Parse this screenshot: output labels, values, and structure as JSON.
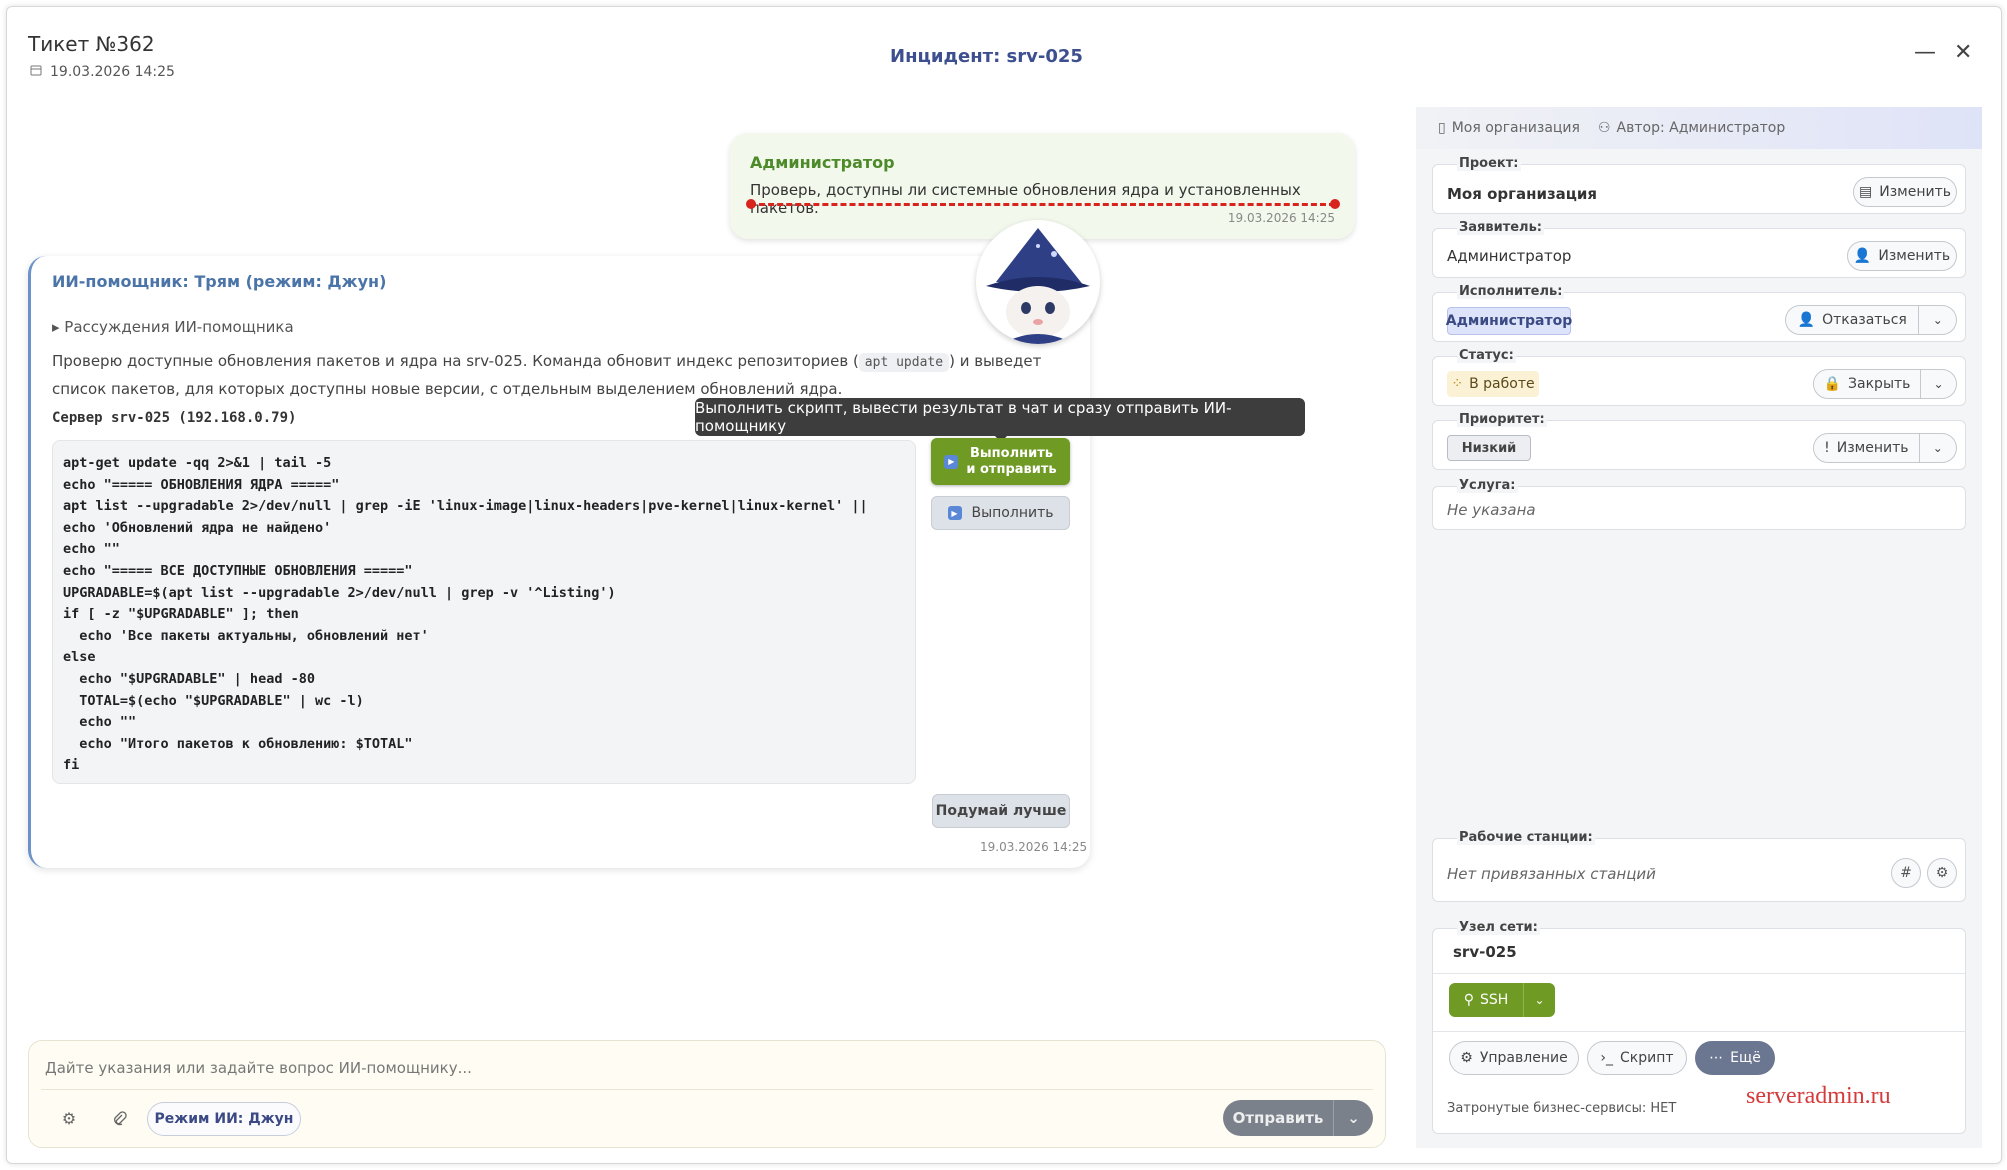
{
  "header": {
    "ticket_title": "Тикет №362",
    "ticket_date": "19.03.2026 14:25",
    "incident_title": "Инцидент: srv-025",
    "minimize": "—",
    "close": "✕"
  },
  "chat": {
    "user_msg": {
      "author": "Администратор",
      "text": "Проверь, доступны ли системные обновления ядра и установленных пакетов.",
      "time": "19.03.2026 14:25"
    },
    "ai_msg": {
      "author": "ИИ-помощник: Трям (режим: Джун)",
      "reasoning": "▸ Рассуждения ИИ-помощника",
      "para_before": "Проверю доступные обновления пакетов и ядра на srv-025. Команда обновит индекс репозиториев (",
      "para_code": "apt update",
      "para_after": ") и выведет список пакетов, для которых доступны новые версии, с отдельным выделением обновлений ядра.",
      "server": "Сервер srv-025 (192.168.0.79)",
      "code": "apt-get update -qq 2>&1 | tail -5\necho \"===== ОБНОВЛЕНИЯ ЯДРА =====\"\napt list --upgradable 2>/dev/null | grep -iE 'linux-image|linux-headers|pve-kernel|linux-kernel' ||\necho 'Обновлений ядра не найдено'\necho \"\"\necho \"===== ВСЕ ДОСТУПНЫЕ ОБНОВЛЕНИЯ =====\"\nUPGRADABLE=$(apt list --upgradable 2>/dev/null | grep -v '^Listing')\nif [ -z \"$UPGRADABLE\" ]; then\n  echo 'Все пакеты актуальны, обновлений нет'\nelse\n  echo \"$UPGRADABLE\" | head -80\n  TOTAL=$(echo \"$UPGRADABLE\" | wc -l)\n  echo \"\"\n  echo \"Итого пакетов к обновлению: $TOTAL\"\nfi",
      "btn_run_send_line1": "Выполнить",
      "btn_run_send_line2": "и отправить",
      "btn_run": "Выполнить",
      "tooltip": "Выполнить скрипт, вывести результат в чат и сразу отправить ИИ-помощнику",
      "btn_think": "Подумай лучше",
      "time": "19.03.2026 14:25"
    }
  },
  "composer": {
    "placeholder": "Дайте указания или задайте вопрос ИИ-помощнику...",
    "mode": "Режим ИИ: Джун",
    "send": "Отправить"
  },
  "panel": {
    "org": "Моя организация",
    "author": "Автор: Администратор",
    "project": {
      "label": "Проект:",
      "value": "Моя организация",
      "btn": "Изменить"
    },
    "requester": {
      "label": "Заявитель:",
      "value": "Администратор",
      "btn": "Изменить"
    },
    "assignee": {
      "label": "Исполнитель:",
      "value": "Администратор",
      "btn": "Отказаться"
    },
    "status": {
      "label": "Статус:",
      "value": "В работе",
      "btn": "Закрыть"
    },
    "priority": {
      "label": "Приоритет:",
      "value": "Низкий",
      "btn": "Изменить"
    },
    "service": {
      "label": "Услуга:",
      "value": "Не указана"
    },
    "workstations": {
      "label": "Рабочие станции:",
      "value": "Нет привязанных станций"
    },
    "node": {
      "label": "Узел сети:",
      "value": "srv-025",
      "ssh": "SSH",
      "manage": "Управление",
      "script": "Скрипт",
      "more": "Ещё",
      "biz": "Затронутые бизнес-сервисы: НЕТ"
    }
  },
  "watermark": "serveradmin.ru",
  "colors": {
    "green": "#6f9a24",
    "blue_title": "#3d4f8f",
    "user_name": "#4d8a2a",
    "ai_name": "#4b74a8"
  }
}
